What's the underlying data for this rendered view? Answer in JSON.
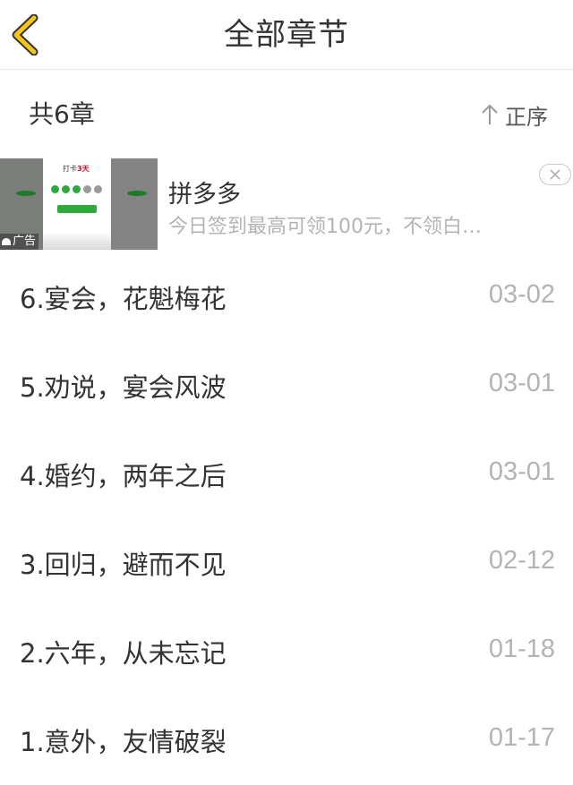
{
  "header": {
    "title": "全部章节",
    "back_icon": "chevron-left-icon",
    "accent_color": "#f5c518"
  },
  "summary": {
    "count_label": "共6章",
    "sort_label": "正序",
    "sort_icon": "arrow-up-icon"
  },
  "ad": {
    "tag": "广告",
    "name": "拼多多",
    "description": "今日签到最高可领100元，不领白…",
    "image_title": "打卡",
    "image_title_highlight": "3天",
    "close_icon": "close-icon"
  },
  "chapters": [
    {
      "title": "6.宴会，花魁梅花",
      "date": "03-02"
    },
    {
      "title": "5.劝说，宴会风波",
      "date": "03-01"
    },
    {
      "title": "4.婚约，两年之后",
      "date": "03-01"
    },
    {
      "title": "3.回归，避而不见",
      "date": "02-12"
    },
    {
      "title": "2.六年，从未忘记",
      "date": "01-18"
    },
    {
      "title": "1.意外，友情破裂",
      "date": "01-17"
    }
  ]
}
